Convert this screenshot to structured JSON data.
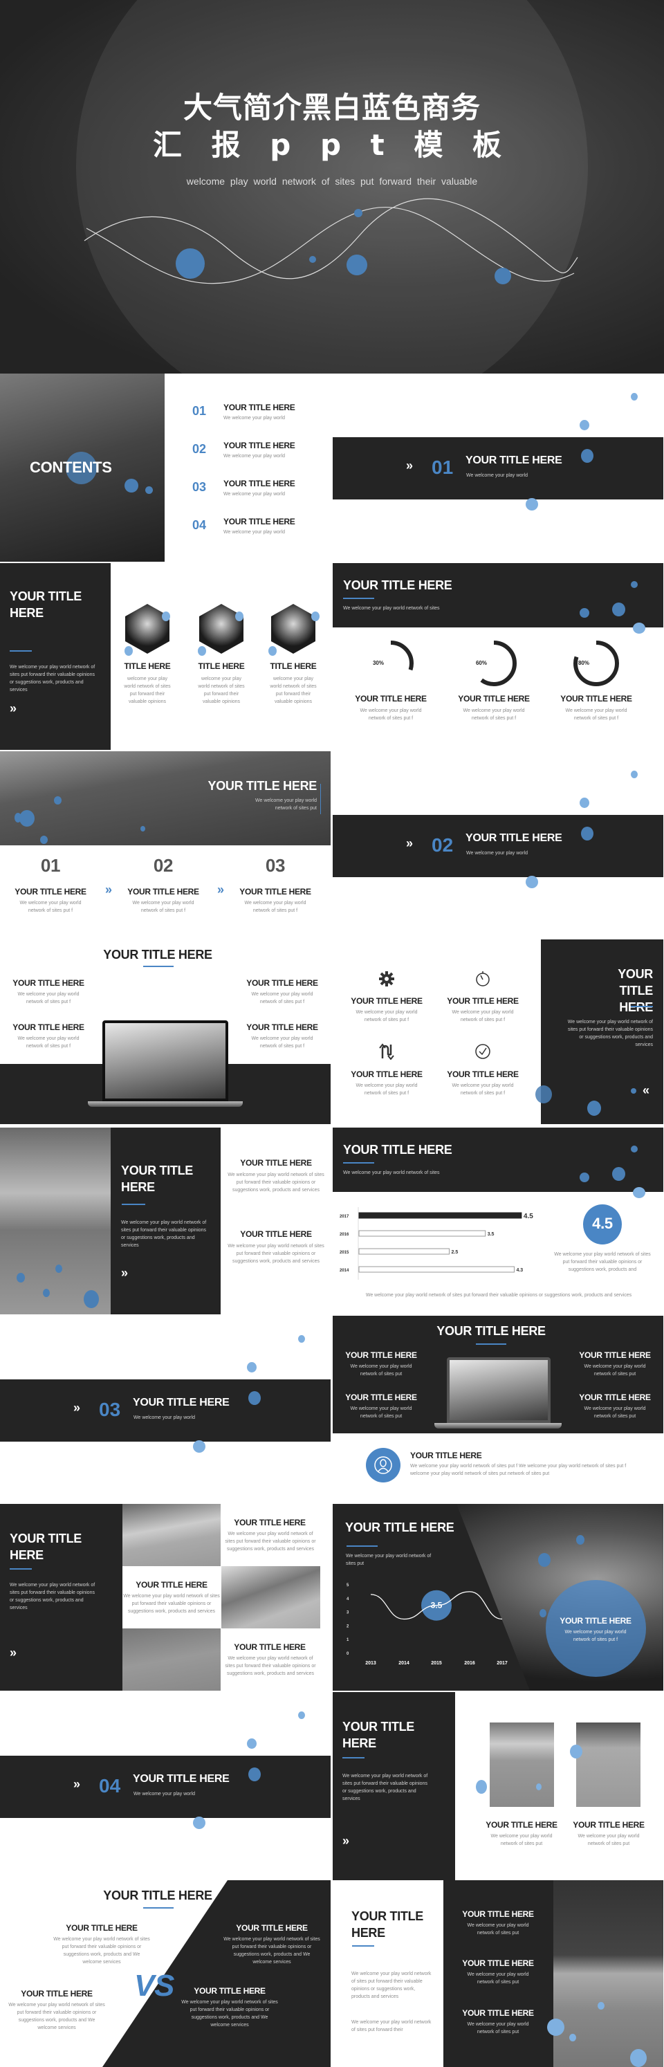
{
  "colors": {
    "accent": "#4a86c5",
    "accent_light": "#7fb0e0",
    "dark": "#242424",
    "text": "#222222",
    "muted": "#8d8d8d"
  },
  "hero": {
    "title_line1": "大气简介黑白蓝色商务",
    "title_line2": "汇 报 p p t 模 板",
    "subtitle": "welcome play world network of sites put forward their valuable"
  },
  "contents": {
    "label": "CONTENTS",
    "items": [
      {
        "num": "01",
        "title": "YOUR TITLE HERE",
        "sub": "We welcome your play world"
      },
      {
        "num": "02",
        "title": "YOUR TITLE HERE",
        "sub": "We welcome your play world"
      },
      {
        "num": "03",
        "title": "YOUR TITLE HERE",
        "sub": "We welcome your play world"
      },
      {
        "num": "04",
        "title": "YOUR TITLE HERE",
        "sub": "We welcome your play world"
      }
    ]
  },
  "sections": [
    {
      "chevron": "»",
      "num": "01",
      "title": "YOUR TITLE HERE",
      "sub": "We welcome your play world"
    },
    {
      "chevron": "»",
      "num": "02",
      "title": "YOUR TITLE HERE",
      "sub": "We welcome your play world"
    },
    {
      "chevron": "»",
      "num": "03",
      "title": "YOUR TITLE HERE",
      "sub": "We welcome your play world"
    },
    {
      "chevron": "»",
      "num": "04",
      "title": "YOUR TITLE HERE",
      "sub": "We welcome your play world"
    }
  ],
  "team": {
    "title": "YOUR TITLE HERE",
    "body": "We welcome your play world network of sites put forward their valuable opinions or suggestions work, products and services",
    "chevron": "»",
    "members": [
      {
        "title": "TITLE HERE",
        "body": "welcome your play world network of sites put forward their valuable opinions"
      },
      {
        "title": "TITLE HERE",
        "body": "welcome your play world network of sites put forward their valuable opinions"
      },
      {
        "title": "TITLE HERE",
        "body": "welcome your play world network of sites put forward their valuable opinions"
      }
    ]
  },
  "progress": {
    "title": "YOUR TITLE HERE",
    "sub": "We welcome your play world network of sites",
    "items": [
      {
        "percent": 30,
        "label": "30%",
        "title": "YOUR TITLE HERE",
        "body": "We welcome your play world network of sites put f"
      },
      {
        "percent": 60,
        "label": "60%",
        "title": "YOUR TITLE HERE",
        "body": "We welcome your play world network of sites put f"
      },
      {
        "percent": 80,
        "label": "80%",
        "title": "YOUR TITLE HERE",
        "body": "We welcome your play world network of sites put f"
      }
    ]
  },
  "steps": {
    "banner_title": "YOUR TITLE HERE",
    "banner_sub": "We welcome your play world network of sites put",
    "chevron": "»",
    "items": [
      {
        "num": "01",
        "title": "YOUR TITLE HERE",
        "body": "We welcome your play world network of sites put f"
      },
      {
        "num": "02",
        "title": "YOUR TITLE HERE",
        "body": "We welcome your play world network of sites put f"
      },
      {
        "num": "03",
        "title": "YOUR TITLE HERE",
        "body": "We welcome your play world network of sites put f"
      }
    ]
  },
  "laptop": {
    "title": "YOUR TITLE HERE",
    "items": [
      {
        "title": "YOUR TITLE HERE",
        "body": "We welcome your play world network of sites put f"
      },
      {
        "title": "YOUR TITLE HERE",
        "body": "We welcome your play world network of sites put f"
      },
      {
        "title": "YOUR TITLE HERE",
        "body": "We welcome your play world network of sites put f"
      },
      {
        "title": "YOUR TITLE HERE",
        "body": "We welcome your play world network of sites put f"
      }
    ]
  },
  "features": {
    "panel_title": "YOUR TITLE HERE",
    "panel_body": "We welcome your play world network of sites put forward their valuable opinions or suggestions work, products and services",
    "chevron": "«",
    "items": [
      {
        "icon": "gear-icon",
        "title": "YOUR TITLE HERE",
        "body": "We welcome your play world network of sites put f"
      },
      {
        "icon": "timer-icon",
        "title": "YOUR TITLE HERE",
        "body": "We welcome your play world network of sites put f"
      },
      {
        "icon": "loop-arrows-icon",
        "title": "YOUR TITLE HERE",
        "body": "We welcome your play world network of sites put f"
      },
      {
        "icon": "check-circle-icon",
        "title": "YOUR TITLE HERE",
        "body": "We welcome your play world network of sites put f"
      }
    ]
  },
  "cliff": {
    "panel_title": "YOUR TITLE HERE",
    "panel_body": "We welcome your play world network of sites put forward their valuable opinions or suggestions work, products and services",
    "chevron": "»",
    "items": [
      {
        "title": "YOUR TITLE HERE",
        "body": "We welcome your play world network of sites put forward their valuable opinions or suggestions work, products and services"
      },
      {
        "title": "YOUR TITLE HERE",
        "body": "We welcome your play world network of sites put forward their valuable opinions or suggestions work, products and services"
      }
    ]
  },
  "bars": {
    "title": "YOUR TITLE HERE",
    "sub": "We welcome your play world network of sites",
    "chart_data": {
      "type": "bar",
      "orientation": "horizontal",
      "categories": [
        "2017",
        "2016",
        "2015",
        "2014"
      ],
      "values": [
        4.5,
        3.5,
        2.5,
        4.3
      ],
      "value_labels": [
        "4.5",
        "3.5",
        "2.5",
        "4.3"
      ],
      "highlighted": "2017",
      "xlim": [
        0,
        4.5
      ]
    },
    "highlight": "4.5",
    "highlight_body": "We welcome your play world network of sites put forward their valuable opinions or suggestions work, products and",
    "footer": "We welcome your play world network of sites put forward their valuable opinions or suggestions work, products and services"
  },
  "laptop_dark": {
    "title": "YOUR TITLE HERE",
    "items": [
      {
        "title": "YOUR TITLE HERE",
        "body": "We welcome your play world network of sites put"
      },
      {
        "title": "YOUR TITLE HERE",
        "body": "We welcome your play world network of sites put"
      },
      {
        "title": "YOUR TITLE HERE",
        "body": "We welcome your play world network of sites put"
      },
      {
        "title": "YOUR TITLE HERE",
        "body": "We welcome your play world network of sites put"
      }
    ]
  },
  "profile": {
    "icon": "person-icon",
    "title": "YOUR TITLE HERE",
    "body": "We welcome your play world network of sites put f We welcome your play world network of sites put f welcome your play world network of sites put network of sites put"
  },
  "grid": {
    "panel_title": "YOUR TITLE HERE",
    "panel_body": "We welcome your play world network of sites put forward their valuable opinions or suggestions work, products and services",
    "chevron": "»",
    "items": [
      {
        "title": "YOUR TITLE HERE",
        "body": "We welcome your play world network of sites put forward their valuable opinions or suggestions work, products and services"
      },
      {
        "title": "YOUR TITLE HERE",
        "body": "We welcome your play world network of sites put forward their valuable opinions or suggestions work, products and services"
      },
      {
        "title": "YOUR TITLE HERE",
        "body": "We welcome your play world network of sites put forward their valuable opinions or suggestions work, products and services"
      }
    ]
  },
  "line_chart": {
    "title": "YOUR TITLE HERE",
    "sub": "We welcome your play world network of sites put",
    "chart_data": {
      "type": "line",
      "x": [
        "2013",
        "2014",
        "2015",
        "2016",
        "2017"
      ],
      "values": [
        4.3,
        2.5,
        3.5,
        4.5,
        2.5
      ],
      "yticks": [
        "5",
        "4",
        "3",
        "2",
        "1",
        "0"
      ],
      "ylim": [
        0,
        5
      ],
      "highlighted": "2015"
    },
    "highlight": "3.5",
    "card_title": "YOUR TITLE HERE",
    "card_body": "We welcome your play world network of sites put f"
  },
  "photos": {
    "panel_title": "YOUR TITLE HERE",
    "panel_body": "We welcome your play world network of sites put forward their valuable opinions or suggestions work, products and services",
    "chevron": "»",
    "items": [
      {
        "title": "YOUR TITLE HERE",
        "body": "We welcome your play world network of sites put"
      },
      {
        "title": "YOUR TITLE HERE",
        "body": "We welcome your play world network of sites put"
      }
    ]
  },
  "vs": {
    "title": "YOUR TITLE HERE",
    "vs": "VS",
    "items": [
      {
        "title": "YOUR TITLE HERE",
        "body": "We welcome your play world network of sites put forward their valuable opinions or suggestions work, products and We welcome services"
      },
      {
        "title": "YOUR TITLE HERE",
        "body": "We welcome your play world network of sites put forward their valuable opinions or suggestions work, products and We welcome services"
      },
      {
        "title": "YOUR TITLE HERE",
        "body": "We welcome your play world network of sites put forward their valuable opinions or suggestions work, products and We welcome services"
      },
      {
        "title": "YOUR TITLE HERE",
        "body": "We welcome your play world network of sites put forward their valuable opinions or suggestions work, products and We welcome services"
      }
    ]
  },
  "final": {
    "title": "YOUR TITLE HERE",
    "body1": "We welcome your play world network of sites put forward their valuable opinions or suggestions work, products and services",
    "body2": "We welcome your play world network of sites put forward their",
    "items": [
      {
        "title": "YOUR TITLE HERE",
        "body": "We welcome your play world network of sites put"
      },
      {
        "title": "YOUR TITLE HERE",
        "body": "We welcome your play world network of sites put"
      },
      {
        "title": "YOUR TITLE HERE",
        "body": "We welcome your play world network of sites put"
      }
    ]
  }
}
